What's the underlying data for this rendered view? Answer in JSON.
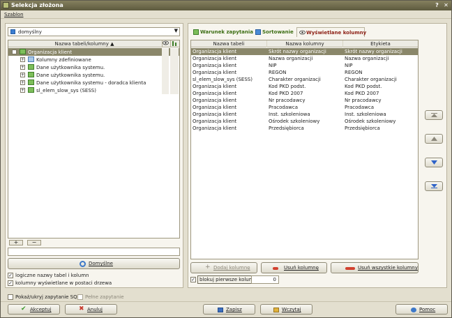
{
  "window": {
    "title": "Selekcja złożona"
  },
  "menu": {
    "items": [
      "Szablon"
    ]
  },
  "left": {
    "combo_value": "domyślny",
    "tree_header": "Nazwa tabeli/kolumny ▲",
    "tree": [
      {
        "label": "Organizacja klient",
        "level": 0,
        "expanded": true,
        "selected": true
      },
      {
        "label": "Kolumny zdefiniowane",
        "level": 1,
        "expanded": false,
        "selected": false
      },
      {
        "label": "Dane użytkownika systemu.",
        "level": 1,
        "expanded": false,
        "selected": false
      },
      {
        "label": "Dane użytkownika systemu.",
        "level": 1,
        "expanded": false,
        "selected": false
      },
      {
        "label": "Dane użytkownika systemu - doradca klienta",
        "level": 1,
        "expanded": false,
        "selected": false
      },
      {
        "label": "sl_elem_slow_sys (SESS)",
        "level": 1,
        "expanded": false,
        "selected": false
      }
    ],
    "add_label": "+",
    "remove_label": "−",
    "filter_value": "",
    "default_button": "Domyślne",
    "checks": [
      {
        "label": "logiczne nazwy tabel i kolumn",
        "checked": true
      },
      {
        "label": "kolumny wyświetlane w postaci drzewa",
        "checked": true
      }
    ]
  },
  "tabs": [
    {
      "label": "Warunek zapytania",
      "active": false,
      "icon": "filter-icon"
    },
    {
      "label": "Sortowanie",
      "active": false,
      "icon": "sort-icon"
    },
    {
      "label": "Wyświetlane kolumny",
      "active": true,
      "icon": "eye-icon"
    }
  ],
  "grid": {
    "columns": [
      "Nazwa tabeli",
      "Nazwa kolumny",
      "Etykieta"
    ],
    "rows": [
      [
        "Organizacja klient",
        "Skrót nazwy organizacji",
        "Skrót nazwy organizacji"
      ],
      [
        "Organizacja klient",
        "Nazwa organizacji",
        "Nazwa organizacji"
      ],
      [
        "Organizacja klient",
        "NIP",
        "NIP"
      ],
      [
        "Organizacja klient",
        "REGON",
        "REGON"
      ],
      [
        "sl_elem_slow_sys (SESS)",
        "Charakter organizacji",
        "Charakter organizacji"
      ],
      [
        "Organizacja klient",
        "Kod PKD podst.",
        "Kod PKD podst."
      ],
      [
        "Organizacja klient",
        "Kod PKD 2007",
        "Kod PKD 2007"
      ],
      [
        "Organizacja klient",
        "Nr pracodawcy",
        "Nr pracodawcy"
      ],
      [
        "Organizacja klient",
        "Pracodawca",
        "Pracodawca"
      ],
      [
        "Organizacja klient",
        "Inst. szkoleniowa",
        "Inst. szkoleniowa"
      ],
      [
        "Organizacja klient",
        "Ośrodek szkoleniowy",
        "Ośrodek szkoleniowy"
      ],
      [
        "Organizacja klient",
        "Przedsiębiorca",
        "Przedsiębiorca"
      ]
    ]
  },
  "grid_buttons": {
    "add": "Dodaj kolumnę",
    "remove": "Usuń kolumnę",
    "remove_all": "Usuń wszystkie kolumny"
  },
  "freeze": {
    "label": "blokuj pierwsze kolumny",
    "checked": true,
    "value": "0"
  },
  "bottom": {
    "show_sql": {
      "label": "Pokaż/ukryj zapytanie SQL",
      "checked": false
    },
    "full_query": {
      "label": "Pełne zapytanie",
      "checked": false
    }
  },
  "footer": {
    "accept": "Akceptuj",
    "cancel": "Anuluj",
    "save": "Zapisz",
    "load": "Wczytaj",
    "help": "Pomoc"
  },
  "colors": {
    "titlebar": "#5d5a3e",
    "selection": "#8a876a",
    "tab_active": "#8c1f14"
  }
}
